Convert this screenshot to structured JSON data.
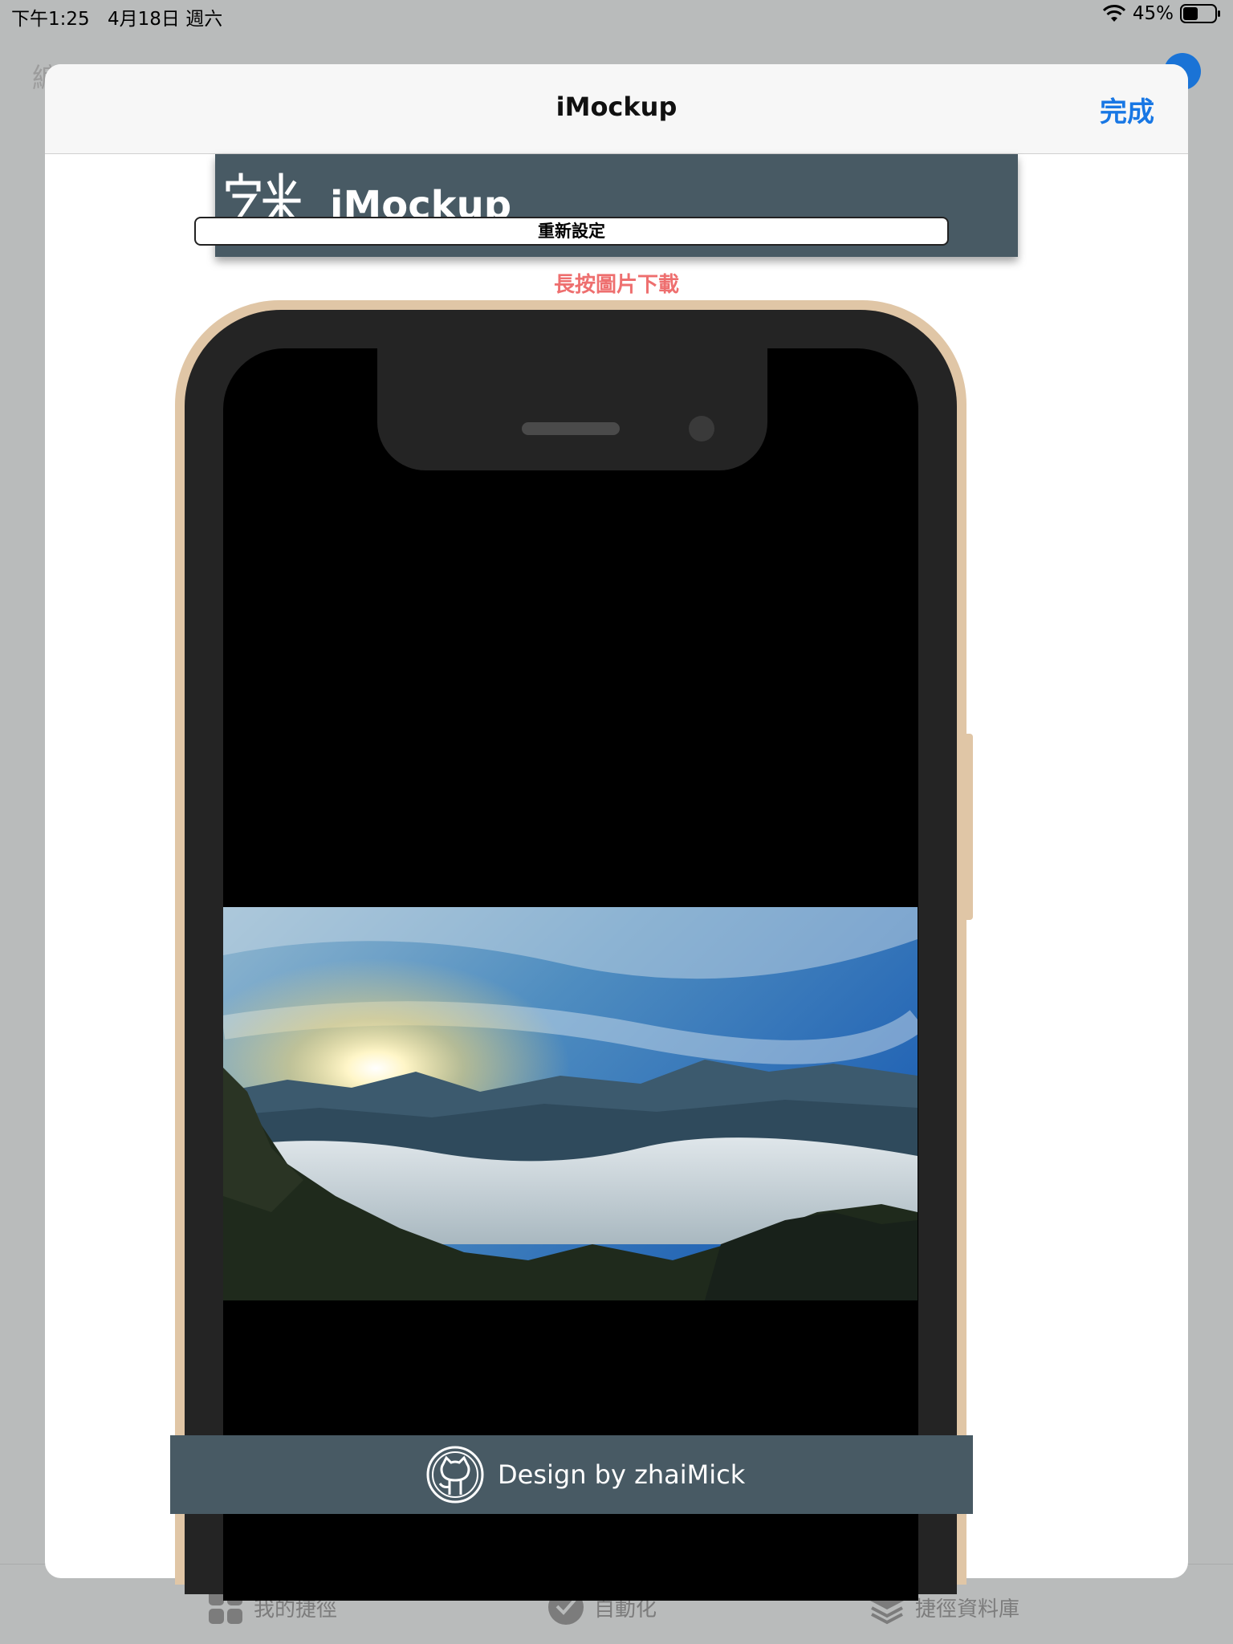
{
  "status_bar": {
    "time": "下午1:25",
    "date": "4月18日 週六",
    "battery": "45%"
  },
  "background_app": {
    "edit_label": "編輯",
    "tabs": [
      {
        "label": "我的捷徑",
        "icon": "grid-icon"
      },
      {
        "label": "自動化",
        "icon": "checkmark-circle-icon"
      },
      {
        "label": "捷徑資料庫",
        "icon": "layers-icon"
      }
    ]
  },
  "sheet": {
    "title": "iMockup",
    "done_label": "完成"
  },
  "web": {
    "header_title": "iMockup",
    "reset_label": "重新設定",
    "hint": "長按圖片下載",
    "footer_text": "Design by zhaiMick"
  },
  "colors": {
    "accent_blue": "#1877e4",
    "header_bg": "#485a64",
    "hint_red": "#ee6f6f",
    "phone_gold": "#e0c6a6"
  }
}
